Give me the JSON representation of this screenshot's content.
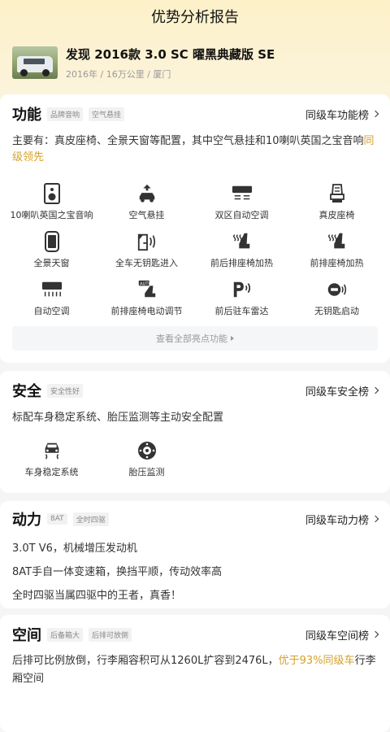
{
  "header": {
    "title": "优势分析报告"
  },
  "car": {
    "name": "发现 2016款 3.0 SC 曜黑典藏版 SE",
    "meta": "2016年 / 16万公里 / 厦门"
  },
  "sections": {
    "function": {
      "title": "功能",
      "tags": [
        "品牌音响",
        "空气悬挂"
      ],
      "rank_link": "同级车功能榜",
      "desc": "主要有：真皮座椅、全景天窗等配置，其中空气悬挂和10喇叭英国之宝音响",
      "desc_highlight": "同级领先",
      "features": [
        {
          "label": "10喇叭英国之宝音响",
          "icon": "speaker-icon"
        },
        {
          "label": "空气悬挂",
          "icon": "air-suspension-icon"
        },
        {
          "label": "双区自动空调",
          "icon": "dual-zone-ac-icon"
        },
        {
          "label": "真皮座椅",
          "icon": "leather-seat-icon"
        },
        {
          "label": "全景天窗",
          "icon": "panoramic-sunroof-icon"
        },
        {
          "label": "全车无钥匙进入",
          "icon": "keyless-entry-icon"
        },
        {
          "label": "前后排座椅加热",
          "icon": "seat-heating-all-icon"
        },
        {
          "label": "前排座椅加热",
          "icon": "seat-heating-front-icon"
        },
        {
          "label": "自动空调",
          "icon": "auto-ac-icon"
        },
        {
          "label": "前排座椅电动调节",
          "icon": "power-seat-icon"
        },
        {
          "label": "前后驻车雷达",
          "icon": "parking-radar-icon"
        },
        {
          "label": "无钥匙启动",
          "icon": "keyless-start-icon"
        }
      ],
      "more_label": "查看全部亮点功能"
    },
    "safety": {
      "title": "安全",
      "tags": [
        "安全性好"
      ],
      "rank_link": "同级车安全榜",
      "desc": "标配车身稳定系统、胎压监测等主动安全配置",
      "features": [
        {
          "label": "车身稳定系统",
          "icon": "stability-control-icon"
        },
        {
          "label": "胎压监测",
          "icon": "tire-pressure-icon"
        }
      ]
    },
    "power": {
      "title": "动力",
      "tags": [
        "8AT",
        "全时四驱"
      ],
      "rank_link": "同级车动力榜",
      "lines": [
        "3.0T V6，机械增压发动机",
        "8AT手自一体变速箱，换挡平顺，传动效率高",
        "全时四驱当属四驱中的王者，真香！"
      ]
    },
    "space": {
      "title": "空间",
      "tags": [
        "后备箱大",
        "后排可放倒"
      ],
      "rank_link": "同级车空间榜",
      "desc_before": "后排可比例放倒，行李厢容积可从1260L扩容到2476L，",
      "desc_highlight": "优于93%同级车",
      "desc_after": "行李厢空间"
    }
  },
  "colors": {
    "accent": "#d6a12b",
    "bg_top": "#fdf1c9"
  }
}
